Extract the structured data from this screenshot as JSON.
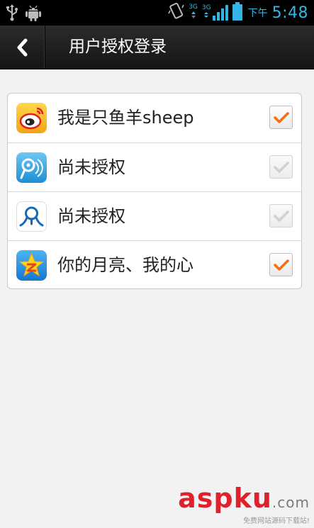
{
  "status_bar": {
    "network_top": "3G",
    "network_bottom": "3G",
    "time_prefix": "下午",
    "time": "5:48",
    "icons": [
      "usb-icon",
      "android-icon",
      "vibrate-icon",
      "signal-icon",
      "battery-icon"
    ]
  },
  "header": {
    "title": "用户授权登录",
    "back_icon": "chevron-left-icon"
  },
  "accounts": [
    {
      "label": "我是只鱼羊sheep",
      "icon": "weibo-icon",
      "checked": true
    },
    {
      "label": "尚未授权",
      "icon": "tencent-weibo-icon",
      "checked": false
    },
    {
      "label": "尚未授权",
      "icon": "renren-icon",
      "checked": false
    },
    {
      "label": "你的月亮、我的心",
      "icon": "qzone-icon",
      "checked": true
    }
  ],
  "watermark": {
    "logo_main": "aspku",
    "logo_suffix": ".com",
    "tagline": "免费网站源码下载站!"
  },
  "colors": {
    "accent_blue": "#33b5e5",
    "check_orange": "#ff6a13",
    "check_gray": "#c8c8c8"
  }
}
